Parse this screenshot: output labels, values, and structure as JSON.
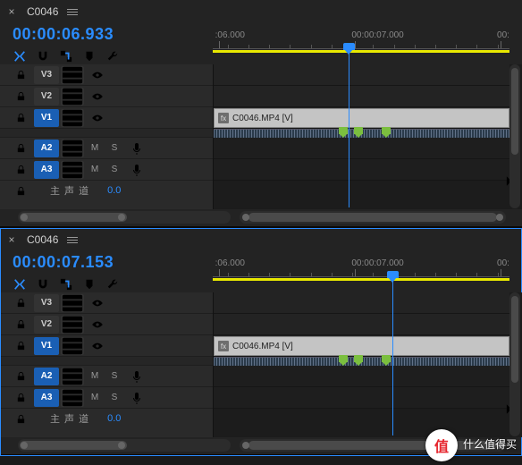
{
  "watermark": {
    "badge": "值",
    "line1": "什么值得买",
    "line2": ""
  },
  "panels": [
    {
      "tab": {
        "close": "×",
        "title": "C0046"
      },
      "timecode": "00:00:06.933",
      "ruler": {
        "labels": [
          ":06.000",
          "00:00:07.000",
          "00:"
        ],
        "positions_pct": [
          2,
          48,
          97
        ]
      },
      "playhead_pct": 44,
      "tracks": {
        "video": [
          {
            "id": "V3",
            "selected": false
          },
          {
            "id": "V2",
            "selected": false
          },
          {
            "id": "V1",
            "selected": true,
            "clip_label": "C0046.MP4 [V]"
          }
        ],
        "audio": [
          {
            "id": "A2",
            "selected": true,
            "m": "M",
            "s": "S"
          },
          {
            "id": "A3",
            "selected": true,
            "m": "M",
            "s": "S"
          }
        ]
      },
      "markers_pct": [
        42,
        47,
        56
      ],
      "mix": {
        "label": "主 声 道",
        "value": "0.0"
      }
    },
    {
      "tab": {
        "close": "×",
        "title": "C0046"
      },
      "timecode": "00:00:07.153",
      "ruler": {
        "labels": [
          ":06.000",
          "00:00:07.000",
          "00:"
        ],
        "positions_pct": [
          2,
          48,
          97
        ]
      },
      "playhead_pct": 58,
      "tracks": {
        "video": [
          {
            "id": "V3",
            "selected": false
          },
          {
            "id": "V2",
            "selected": false
          },
          {
            "id": "V1",
            "selected": true,
            "clip_label": "C0046.MP4 [V]"
          }
        ],
        "audio": [
          {
            "id": "A2",
            "selected": true,
            "m": "M",
            "s": "S"
          },
          {
            "id": "A3",
            "selected": true,
            "m": "M",
            "s": "S"
          }
        ]
      },
      "markers_pct": [
        42,
        47,
        56
      ],
      "mix": {
        "label": "主 声 道",
        "value": "0.0"
      }
    }
  ]
}
